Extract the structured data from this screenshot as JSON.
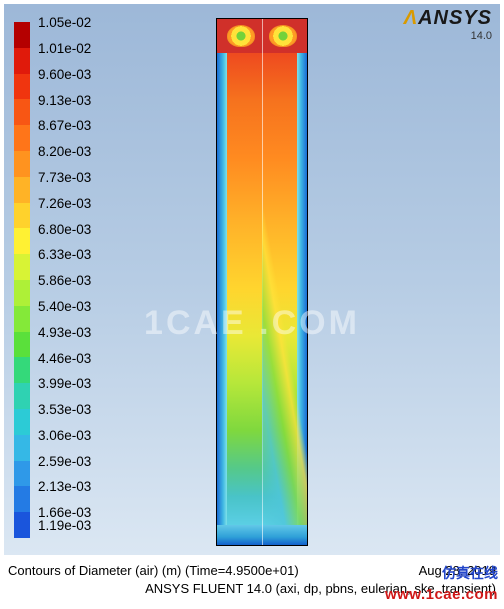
{
  "software": {
    "brand_prefix": "ANSYS",
    "version": "14.0"
  },
  "colorbar": {
    "unit": "m",
    "levels": [
      {
        "value": "1.05e-02",
        "color": "#b40000"
      },
      {
        "value": "1.01e-02",
        "color": "#e01a0b"
      },
      {
        "value": "9.60e-03",
        "color": "#f0350f"
      },
      {
        "value": "9.13e-03",
        "color": "#f85614"
      },
      {
        "value": "8.67e-03",
        "color": "#ff7519"
      },
      {
        "value": "8.20e-03",
        "color": "#ff931f"
      },
      {
        "value": "7.73e-03",
        "color": "#ffb326"
      },
      {
        "value": "7.26e-03",
        "color": "#ffd22c"
      },
      {
        "value": "6.80e-03",
        "color": "#fff133"
      },
      {
        "value": "6.33e-03",
        "color": "#d8f335"
      },
      {
        "value": "5.86e-03",
        "color": "#aef037"
      },
      {
        "value": "5.40e-03",
        "color": "#84e939"
      },
      {
        "value": "4.93e-03",
        "color": "#5ae03b"
      },
      {
        "value": "4.46e-03",
        "color": "#34d97a"
      },
      {
        "value": "3.99e-03",
        "color": "#2fd2b2"
      },
      {
        "value": "3.53e-03",
        "color": "#2ccbd6"
      },
      {
        "value": "3.06e-03",
        "color": "#35b8e6"
      },
      {
        "value": "2.59e-03",
        "color": "#2f99e8"
      },
      {
        "value": "2.13e-03",
        "color": "#247be4"
      },
      {
        "value": "1.66e-03",
        "color": "#1a55dc"
      },
      {
        "value": "1.19e-03",
        "color": "#0a18c0"
      }
    ]
  },
  "caption": {
    "line1_left": "Contours of Diameter (air)  (m)  (Time=4.9500e+01)",
    "line1_right": "Aug 28, 2019",
    "line2_left": "",
    "line2_right": "ANSYS FLUENT 14.0 (axi, dp, pbns, eulerian, ske, transient)"
  },
  "watermark": "1CAE .COM",
  "stamp": {
    "cn": "仿真在线",
    "url": "www.1cae.com"
  },
  "chart_data": {
    "type": "contour",
    "title": "Contours of Diameter (air) (m)",
    "time_s": 49.5,
    "scalar_name": "Diameter (air)",
    "scalar_unit": "m",
    "range": {
      "min": 0.00119,
      "max": 0.0105
    },
    "tick_values": [
      0.00119,
      0.00166,
      0.00213,
      0.00259,
      0.00306,
      0.00353,
      0.00399,
      0.00446,
      0.00493,
      0.0054,
      0.00586,
      0.00633,
      0.0068,
      0.00726,
      0.00773,
      0.0082,
      0.00867,
      0.00913,
      0.0096,
      0.0101,
      0.0105
    ],
    "colormap": "rainbow",
    "solver": "ANSYS FLUENT 14.0",
    "solver_keywords": [
      "axi",
      "dp",
      "pbns",
      "eulerian",
      "ske",
      "transient"
    ],
    "geometry_note": "Tall axisymmetric rectangular column; high values in upper core decreasing toward walls and base; two recirculation eyes at the top cap."
  }
}
